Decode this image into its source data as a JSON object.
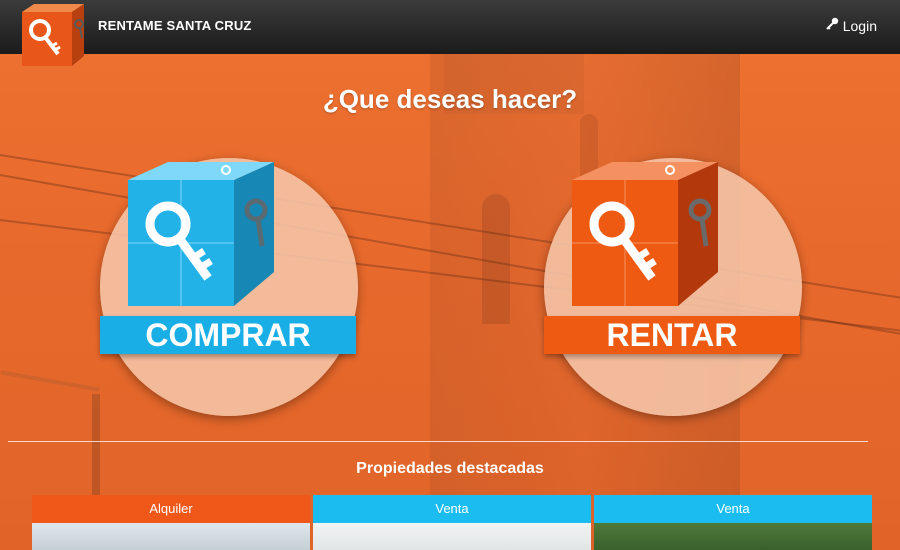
{
  "navbar": {
    "brand": "RENTAME SANTA CRUZ",
    "login_label": "Login",
    "login_icon": "key-icon"
  },
  "hero": {
    "question": "¿Que deseas hacer?",
    "options": [
      {
        "label": "COMPRAR",
        "icon": "key-cube-icon",
        "color": "#1aaee6"
      },
      {
        "label": "RENTAR",
        "icon": "key-cube-icon",
        "color": "#ef5a12"
      }
    ]
  },
  "featured": {
    "title": "Propiedades destacadas",
    "cards": [
      {
        "type": "Alquiler",
        "color": "#f0581a"
      },
      {
        "type": "Venta",
        "color": "#1bbcf0"
      },
      {
        "type": "Venta",
        "color": "#1bbcf0"
      }
    ]
  }
}
